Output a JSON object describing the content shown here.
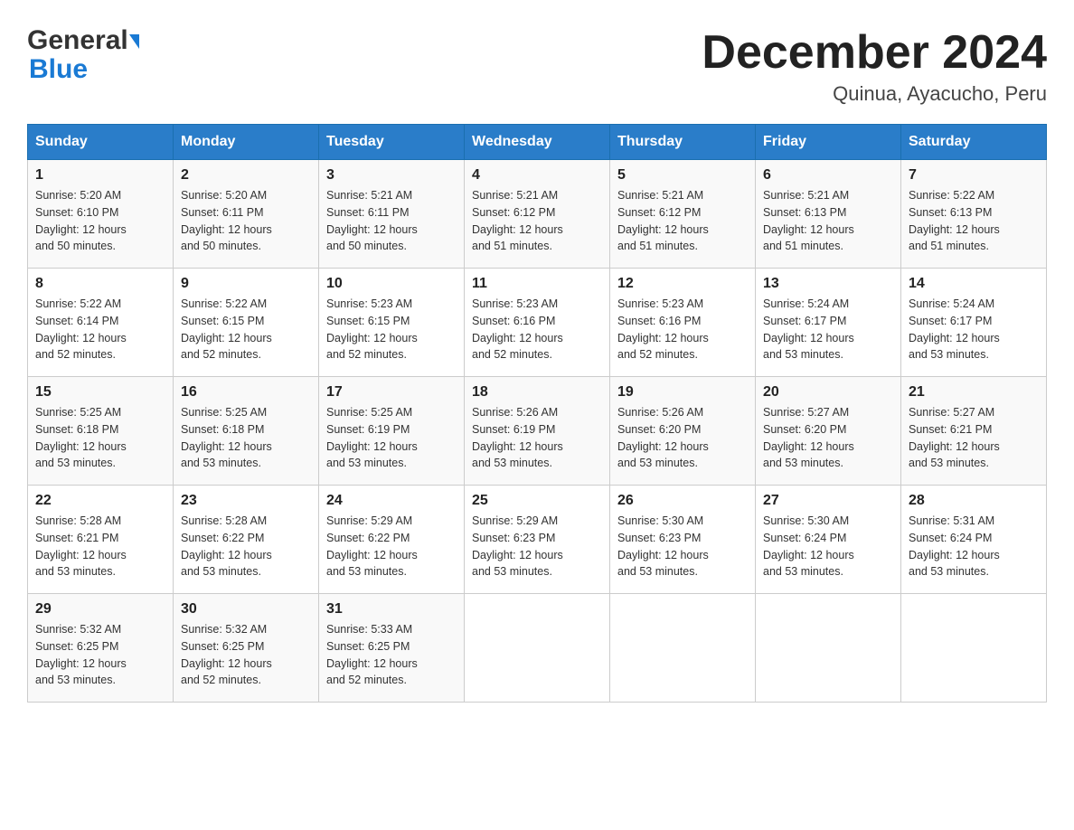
{
  "header": {
    "logo_general": "General",
    "logo_blue": "Blue",
    "month_title": "December 2024",
    "location": "Quinua, Ayacucho, Peru"
  },
  "days_of_week": [
    "Sunday",
    "Monday",
    "Tuesday",
    "Wednesday",
    "Thursday",
    "Friday",
    "Saturday"
  ],
  "weeks": [
    [
      {
        "day": "1",
        "info": "Sunrise: 5:20 AM\nSunset: 6:10 PM\nDaylight: 12 hours\nand 50 minutes."
      },
      {
        "day": "2",
        "info": "Sunrise: 5:20 AM\nSunset: 6:11 PM\nDaylight: 12 hours\nand 50 minutes."
      },
      {
        "day": "3",
        "info": "Sunrise: 5:21 AM\nSunset: 6:11 PM\nDaylight: 12 hours\nand 50 minutes."
      },
      {
        "day": "4",
        "info": "Sunrise: 5:21 AM\nSunset: 6:12 PM\nDaylight: 12 hours\nand 51 minutes."
      },
      {
        "day": "5",
        "info": "Sunrise: 5:21 AM\nSunset: 6:12 PM\nDaylight: 12 hours\nand 51 minutes."
      },
      {
        "day": "6",
        "info": "Sunrise: 5:21 AM\nSunset: 6:13 PM\nDaylight: 12 hours\nand 51 minutes."
      },
      {
        "day": "7",
        "info": "Sunrise: 5:22 AM\nSunset: 6:13 PM\nDaylight: 12 hours\nand 51 minutes."
      }
    ],
    [
      {
        "day": "8",
        "info": "Sunrise: 5:22 AM\nSunset: 6:14 PM\nDaylight: 12 hours\nand 52 minutes."
      },
      {
        "day": "9",
        "info": "Sunrise: 5:22 AM\nSunset: 6:15 PM\nDaylight: 12 hours\nand 52 minutes."
      },
      {
        "day": "10",
        "info": "Sunrise: 5:23 AM\nSunset: 6:15 PM\nDaylight: 12 hours\nand 52 minutes."
      },
      {
        "day": "11",
        "info": "Sunrise: 5:23 AM\nSunset: 6:16 PM\nDaylight: 12 hours\nand 52 minutes."
      },
      {
        "day": "12",
        "info": "Sunrise: 5:23 AM\nSunset: 6:16 PM\nDaylight: 12 hours\nand 52 minutes."
      },
      {
        "day": "13",
        "info": "Sunrise: 5:24 AM\nSunset: 6:17 PM\nDaylight: 12 hours\nand 53 minutes."
      },
      {
        "day": "14",
        "info": "Sunrise: 5:24 AM\nSunset: 6:17 PM\nDaylight: 12 hours\nand 53 minutes."
      }
    ],
    [
      {
        "day": "15",
        "info": "Sunrise: 5:25 AM\nSunset: 6:18 PM\nDaylight: 12 hours\nand 53 minutes."
      },
      {
        "day": "16",
        "info": "Sunrise: 5:25 AM\nSunset: 6:18 PM\nDaylight: 12 hours\nand 53 minutes."
      },
      {
        "day": "17",
        "info": "Sunrise: 5:25 AM\nSunset: 6:19 PM\nDaylight: 12 hours\nand 53 minutes."
      },
      {
        "day": "18",
        "info": "Sunrise: 5:26 AM\nSunset: 6:19 PM\nDaylight: 12 hours\nand 53 minutes."
      },
      {
        "day": "19",
        "info": "Sunrise: 5:26 AM\nSunset: 6:20 PM\nDaylight: 12 hours\nand 53 minutes."
      },
      {
        "day": "20",
        "info": "Sunrise: 5:27 AM\nSunset: 6:20 PM\nDaylight: 12 hours\nand 53 minutes."
      },
      {
        "day": "21",
        "info": "Sunrise: 5:27 AM\nSunset: 6:21 PM\nDaylight: 12 hours\nand 53 minutes."
      }
    ],
    [
      {
        "day": "22",
        "info": "Sunrise: 5:28 AM\nSunset: 6:21 PM\nDaylight: 12 hours\nand 53 minutes."
      },
      {
        "day": "23",
        "info": "Sunrise: 5:28 AM\nSunset: 6:22 PM\nDaylight: 12 hours\nand 53 minutes."
      },
      {
        "day": "24",
        "info": "Sunrise: 5:29 AM\nSunset: 6:22 PM\nDaylight: 12 hours\nand 53 minutes."
      },
      {
        "day": "25",
        "info": "Sunrise: 5:29 AM\nSunset: 6:23 PM\nDaylight: 12 hours\nand 53 minutes."
      },
      {
        "day": "26",
        "info": "Sunrise: 5:30 AM\nSunset: 6:23 PM\nDaylight: 12 hours\nand 53 minutes."
      },
      {
        "day": "27",
        "info": "Sunrise: 5:30 AM\nSunset: 6:24 PM\nDaylight: 12 hours\nand 53 minutes."
      },
      {
        "day": "28",
        "info": "Sunrise: 5:31 AM\nSunset: 6:24 PM\nDaylight: 12 hours\nand 53 minutes."
      }
    ],
    [
      {
        "day": "29",
        "info": "Sunrise: 5:32 AM\nSunset: 6:25 PM\nDaylight: 12 hours\nand 53 minutes."
      },
      {
        "day": "30",
        "info": "Sunrise: 5:32 AM\nSunset: 6:25 PM\nDaylight: 12 hours\nand 52 minutes."
      },
      {
        "day": "31",
        "info": "Sunrise: 5:33 AM\nSunset: 6:25 PM\nDaylight: 12 hours\nand 52 minutes."
      },
      {
        "day": "",
        "info": ""
      },
      {
        "day": "",
        "info": ""
      },
      {
        "day": "",
        "info": ""
      },
      {
        "day": "",
        "info": ""
      }
    ]
  ],
  "colors": {
    "header_bg": "#2a7dc9",
    "header_text": "#ffffff",
    "border": "#cccccc"
  }
}
